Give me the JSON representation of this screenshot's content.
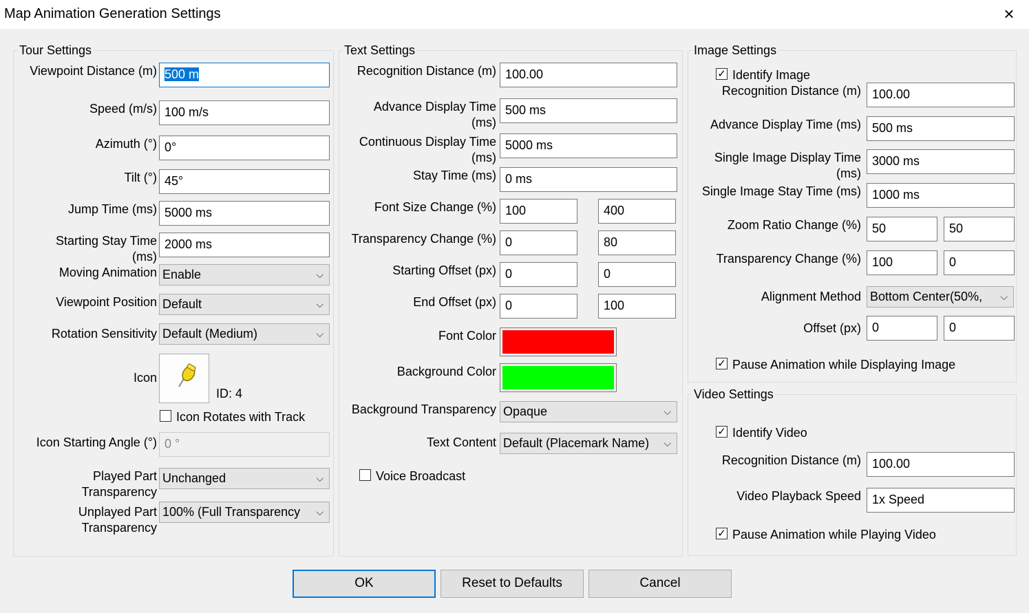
{
  "window": {
    "title": "Map Animation Generation Settings"
  },
  "tour": {
    "title": "Tour Settings",
    "viewpoint_distance": {
      "label": "Viewpoint Distance (m)",
      "value": "500 m"
    },
    "speed": {
      "label": "Speed (m/s)",
      "value": "100 m/s"
    },
    "azimuth": {
      "label": "Azimuth (°)",
      "value": "0°"
    },
    "tilt": {
      "label": "Tilt (°)",
      "value": "45°"
    },
    "jump_time": {
      "label": "Jump Time (ms)",
      "value": "5000 ms"
    },
    "starting_stay_time": {
      "label1": "Starting Stay Time",
      "label2": "(ms)",
      "value": "2000 ms"
    },
    "moving_animation": {
      "label": "Moving Animation",
      "value": "Enable"
    },
    "viewpoint_position": {
      "label": "Viewpoint Position",
      "value": "Default"
    },
    "rotation_sensitivity": {
      "label": "Rotation Sensitivity",
      "value": "Default (Medium)"
    },
    "icon": {
      "label": "Icon",
      "id_text": "ID: 4"
    },
    "icon_rotates": {
      "label": "Icon Rotates with Track",
      "checked": false
    },
    "icon_starting_angle": {
      "label": "Icon Starting Angle (°)",
      "value": "0 °"
    },
    "played_part": {
      "label1": "Played Part",
      "label2": "Transparency",
      "value": "Unchanged"
    },
    "unplayed_part": {
      "label1": "Unplayed Part",
      "label2": "Transparency",
      "value": "100% (Full Transparency"
    }
  },
  "text": {
    "title": "Text Settings",
    "recognition_distance": {
      "label": "Recognition Distance (m)",
      "value": "100.00"
    },
    "advance_display_time": {
      "label1": "Advance Display Time",
      "label2": "(ms)",
      "value": "500 ms"
    },
    "continuous_display_time": {
      "label1": "Continuous Display Time",
      "label2": "(ms)",
      "value": "5000 ms"
    },
    "stay_time": {
      "label": "Stay Time (ms)",
      "value": "0 ms"
    },
    "font_size_change": {
      "label": "Font Size Change (%)",
      "from": "100",
      "to": "400"
    },
    "transparency_change": {
      "label": "Transparency Change (%)",
      "from": "0",
      "to": "80"
    },
    "starting_offset": {
      "label": "Starting Offset (px)",
      "x": "0",
      "y": "0"
    },
    "end_offset": {
      "label": "End Offset (px)",
      "x": "0",
      "y": "100"
    },
    "font_color": {
      "label": "Font Color",
      "color": "#ff0000"
    },
    "background_color": {
      "label": "Background Color",
      "color": "#00ff00"
    },
    "background_transparency": {
      "label": "Background Transparency",
      "value": "Opaque"
    },
    "text_content": {
      "label": "Text Content",
      "value": "Default (Placemark Name)"
    },
    "voice_broadcast": {
      "label": "Voice Broadcast",
      "checked": false
    }
  },
  "image": {
    "title": "Image Settings",
    "identify_image": {
      "label": "Identify Image",
      "checked": true
    },
    "recognition_distance": {
      "label": "Recognition Distance (m)",
      "value": "100.00"
    },
    "advance_display_time": {
      "label": "Advance Display Time (ms)",
      "value": "500 ms"
    },
    "single_image_display_time": {
      "label1": "Single Image Display Time",
      "label2": "(ms)",
      "value": "3000 ms"
    },
    "single_image_stay_time": {
      "label": "Single Image Stay Time (ms)",
      "value": "1000 ms"
    },
    "zoom_ratio_change": {
      "label": "Zoom Ratio Change (%)",
      "from": "50",
      "to": "50"
    },
    "transparency_change": {
      "label": "Transparency Change (%)",
      "from": "100",
      "to": "0"
    },
    "alignment_method": {
      "label": "Alignment Method",
      "value": "Bottom Center(50%,"
    },
    "offset": {
      "label": "Offset (px)",
      "x": "0",
      "y": "0"
    },
    "pause_animation": {
      "label": "Pause Animation while Displaying Image",
      "checked": true
    }
  },
  "video": {
    "title": "Video Settings",
    "identify_video": {
      "label": "Identify Video",
      "checked": true
    },
    "recognition_distance": {
      "label": "Recognition Distance (m)",
      "value": "100.00"
    },
    "playback_speed": {
      "label": "Video Playback Speed",
      "value": "1x Speed"
    },
    "pause_animation": {
      "label": "Pause Animation while Playing Video",
      "checked": true
    }
  },
  "buttons": {
    "ok": "OK",
    "reset": "Reset to Defaults",
    "cancel": "Cancel"
  },
  "icons": {
    "close": "×",
    "check": "✓",
    "dropdown": "⌵",
    "pin": "pushpin-icon"
  }
}
